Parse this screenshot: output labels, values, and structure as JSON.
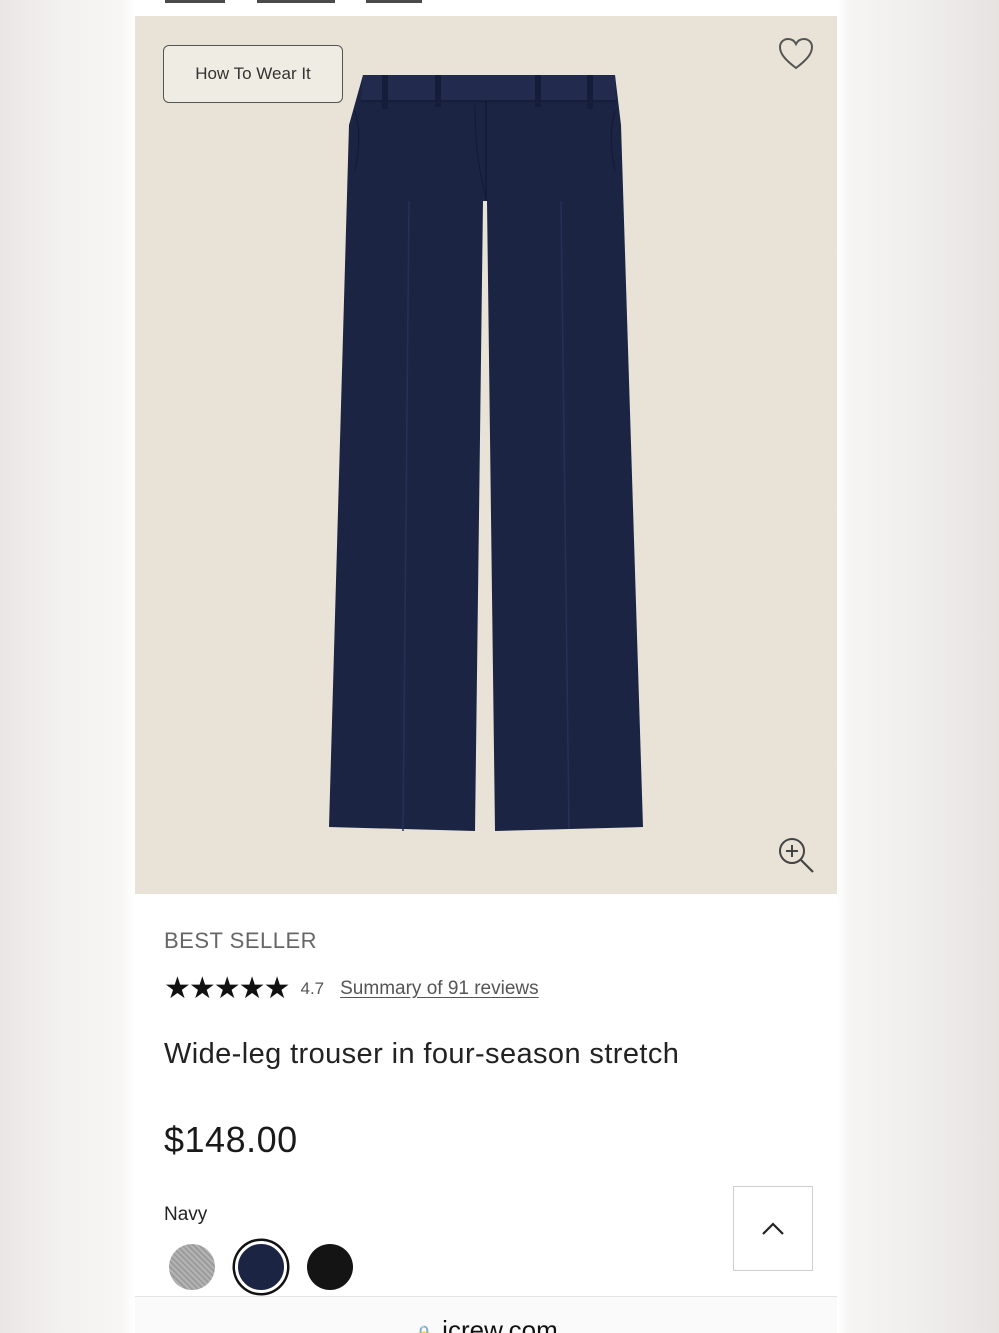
{
  "hero": {
    "how_to_wear_label": "How To Wear It",
    "background_color": "#e8e3d6",
    "product_color": "#1c2444"
  },
  "product": {
    "badge": "BEST SELLER",
    "stars": "★★★★★",
    "rating": "4.7",
    "reviews_link": "Summary of 91 reviews",
    "rating_value": 4.7,
    "title": "Wide-leg trouser in four-season stretch",
    "price": "$148.00",
    "selected_color": "Navy",
    "swatches": [
      {
        "name": "grey",
        "color": "#a8a8a8"
      },
      {
        "name": "navy",
        "color": "#1c2444",
        "selected": true
      },
      {
        "name": "black",
        "color": "#141414"
      }
    ]
  },
  "browser": {
    "url": "jcrew.com"
  },
  "icons": {
    "heart": "heart-icon",
    "zoom": "zoom-in-icon",
    "scroll_top": "chevron-up-icon",
    "lock": "lock-icon"
  }
}
